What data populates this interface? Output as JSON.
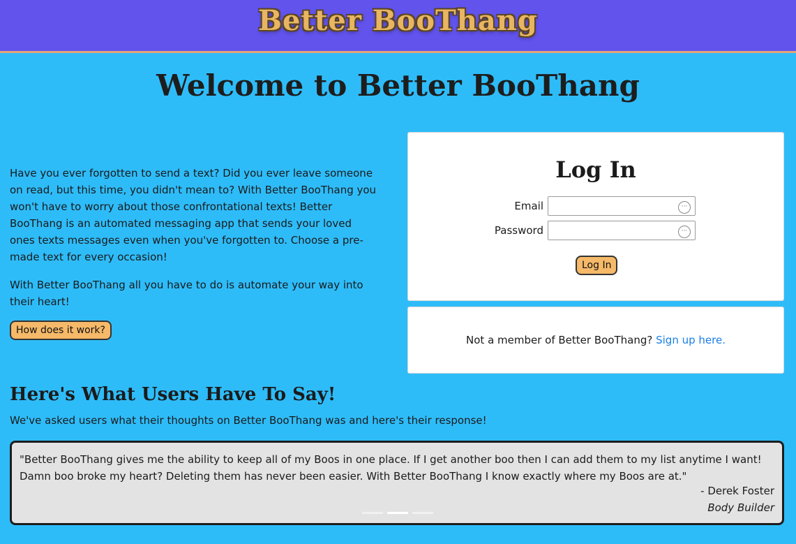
{
  "header": {
    "brand": "Better BooThang"
  },
  "main": {
    "title": "Welcome to Better BooThang",
    "intro_paragraph_1": "Have you ever forgotten to send a text? Did you ever leave someone on read, but this time, you didn't mean to? With Better BooThang you won't have to worry about those confrontational texts! Better BooThang is an automated messaging app that sends your loved ones texts messages even when you've forgotten to. Choose a pre-made text for every occasion!",
    "intro_paragraph_2": "With Better BooThang all you have to do is automate your way into their heart!",
    "how_button": "How does it work?"
  },
  "login": {
    "title": "Log In",
    "email_label": "Email",
    "email_value": "",
    "password_label": "Password",
    "password_value": "",
    "submit": "Log In"
  },
  "signup": {
    "text": "Not a member of Better BooThang? ",
    "link": "Sign up here."
  },
  "testimonials": {
    "heading": "Here's What Users Have To Say!",
    "subheading": "We've asked users what their thoughts on Better BooThang was and here's their response!",
    "quote": "\"Better BooThang gives me the ability to keep all of my Boos in one place. If I get another boo then I can add them to my list anytime I want! Damn boo broke my heart? Deleting them has never been easier. With Better BooThang I know exactly where my Boos are at.\"",
    "author": "- Derek Foster",
    "role": "Body Builder",
    "active_slide": 2,
    "slide_count": 3
  },
  "colors": {
    "navbar": "#6153ec",
    "background": "#2ebcf9",
    "button": "#f5b969",
    "brand_text": "#e8b562",
    "link": "#1a7fe6"
  },
  "icons": [
    "password-manager-icon"
  ]
}
